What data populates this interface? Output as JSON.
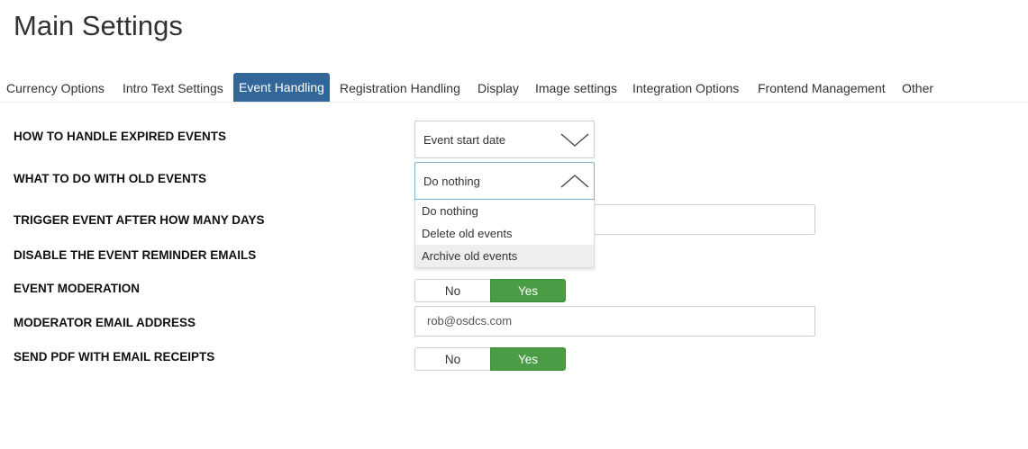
{
  "page": {
    "title": "Main Settings"
  },
  "tabs": [
    {
      "label": "Currency Options"
    },
    {
      "label": "Intro Text Settings"
    },
    {
      "label": "Event Handling",
      "active": true
    },
    {
      "label": "Registration Handling"
    },
    {
      "label": "Display"
    },
    {
      "label": "Image settings"
    },
    {
      "label": "Integration Options"
    },
    {
      "label": "Frontend Management"
    },
    {
      "label": "Other"
    }
  ],
  "settings": {
    "expired_events": {
      "label": "HOW TO HANDLE EXPIRED EVENTS",
      "value": "Event start date"
    },
    "old_events": {
      "label": "WHAT TO DO WITH OLD EVENTS",
      "value": "Do nothing",
      "open": true,
      "options": [
        "Do nothing",
        "Delete old events",
        "Archive old events"
      ],
      "highlighted": "Archive old events"
    },
    "trigger_days": {
      "label": "TRIGGER EVENT AFTER HOW MANY DAYS",
      "value": ""
    },
    "disable_reminders": {
      "label": "DISABLE THE EVENT REMINDER EMAILS"
    },
    "moderation": {
      "label": "EVENT MODERATION",
      "no_label": "No",
      "yes_label": "Yes",
      "selected": "Yes"
    },
    "moderator_email": {
      "label": "MODERATOR EMAIL ADDRESS",
      "value": "rob@osdcs.com"
    },
    "send_pdf": {
      "label": "SEND PDF WITH EMAIL RECEIPTS",
      "no_label": "No",
      "yes_label": "Yes",
      "selected": "Yes"
    }
  },
  "colors": {
    "active_tab": "#336699",
    "toggle_on": "#4a9c45"
  }
}
